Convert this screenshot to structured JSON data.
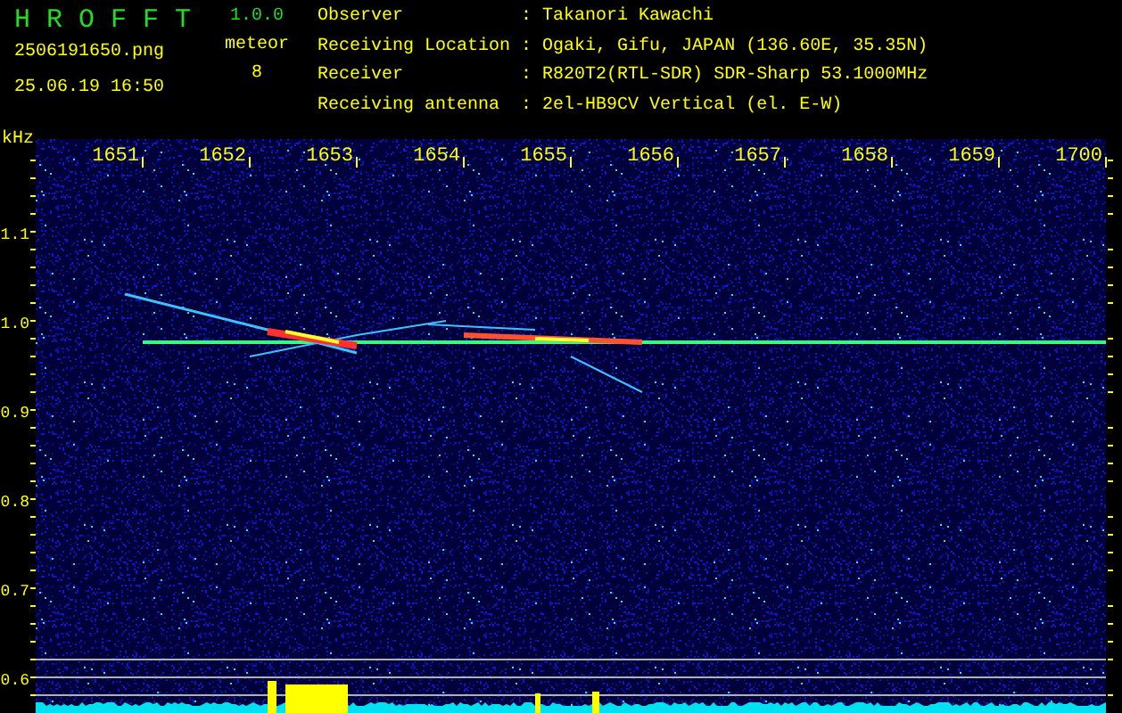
{
  "header": {
    "title": "H R O F F T",
    "version": "1.0.0",
    "filename": "2506191650.png",
    "datetime": "25.06.19 16:50",
    "detection_label": "meteor",
    "detection_count": "8",
    "info": {
      "separator": ":",
      "rows": [
        {
          "label": "Observer",
          "value": "Takanori Kawachi"
        },
        {
          "label": "Receiving Location",
          "value": "Ogaki, Gifu, JAPAN (136.60E, 35.35N)"
        },
        {
          "label": "Receiver",
          "value": "R820T2(RTL-SDR) SDR-Sharp 53.1000MHz"
        },
        {
          "label": "Receiving antenna",
          "value": "2el-HB9CV Vertical (el. E-W)"
        }
      ]
    }
  },
  "plot": {
    "y_unit": "kHz",
    "x_labels": [
      "1651",
      "1652",
      "1653",
      "1654",
      "1655",
      "1656",
      "1657",
      "1658",
      "1659",
      "1700"
    ],
    "y_labels": [
      "1.1",
      "1.0",
      "0.9",
      "0.8",
      "0.7",
      "0.6"
    ]
  }
}
